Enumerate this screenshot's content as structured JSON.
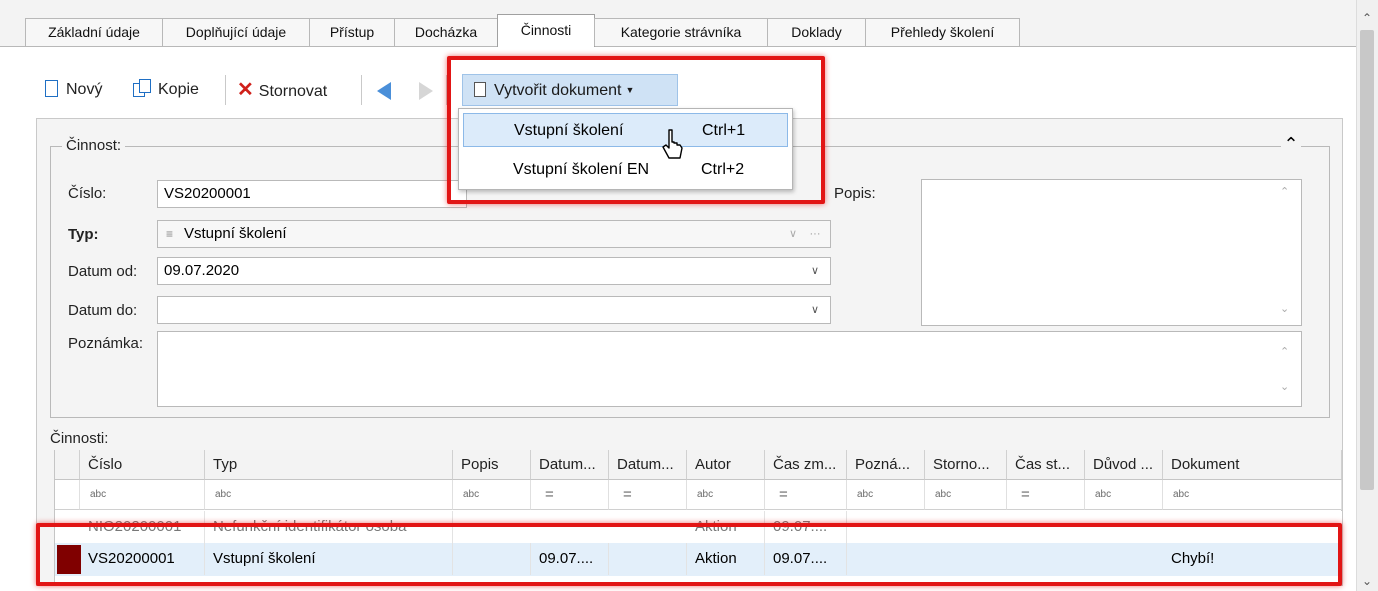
{
  "tabs": [
    "Základní údaje",
    "Doplňující údaje",
    "Přístup",
    "Docházka",
    "Činnosti",
    "Kategorie strávníka",
    "Doklady",
    "Přehledy školení"
  ],
  "toolbar": {
    "new_label": "Nový",
    "copy_label": "Kopie",
    "cancel_label": "Stornovat",
    "create_doc_label": "Vytvořit dokument"
  },
  "menu": [
    {
      "label": "Vstupní školení",
      "shortcut": "Ctrl+1"
    },
    {
      "label": "Vstupní školení EN",
      "shortcut": "Ctrl+2"
    }
  ],
  "group": {
    "legend": "Činnost:",
    "cislo_label": "Číslo:",
    "cislo_value": "VS20200001",
    "typ_label": "Typ:",
    "typ_value": "Vstupní školení",
    "datum_od_label": "Datum od:",
    "datum_od_value": "09.07.2020",
    "datum_do_label": "Datum do:",
    "datum_do_value": "",
    "poznamka_label": "Poznámka:",
    "popis_label": "Popis:"
  },
  "grid": {
    "title": "Činnosti:",
    "columns": [
      "Číslo",
      "Typ",
      "Popis",
      "Datum...",
      "Datum...",
      "Autor",
      "Čas zm...",
      "Pozná...",
      "Storno...",
      "Čas st...",
      "Důvod ...",
      "Dokument"
    ],
    "filter_icons": [
      "abc",
      "abc",
      "abc",
      "=",
      "=",
      "abc",
      "=",
      "abc",
      "abc",
      "=",
      "abc",
      "abc"
    ],
    "rows": [
      [
        "NIO20200001",
        "Nefunkční identifikátor osoba",
        "",
        "",
        "",
        "Aktion",
        "09.07....",
        "",
        "",
        "",
        "",
        ""
      ],
      [
        "VS20200001",
        "Vstupní školení",
        "",
        "09.07....",
        "",
        "Aktion",
        "09.07....",
        "",
        "",
        "",
        "",
        "Chybí!"
      ]
    ]
  },
  "colors": {
    "highlight": "#e21515",
    "selected_row": "#e3effa",
    "row_marker": "#800000",
    "create_doc_button": "#cfe2f5"
  }
}
